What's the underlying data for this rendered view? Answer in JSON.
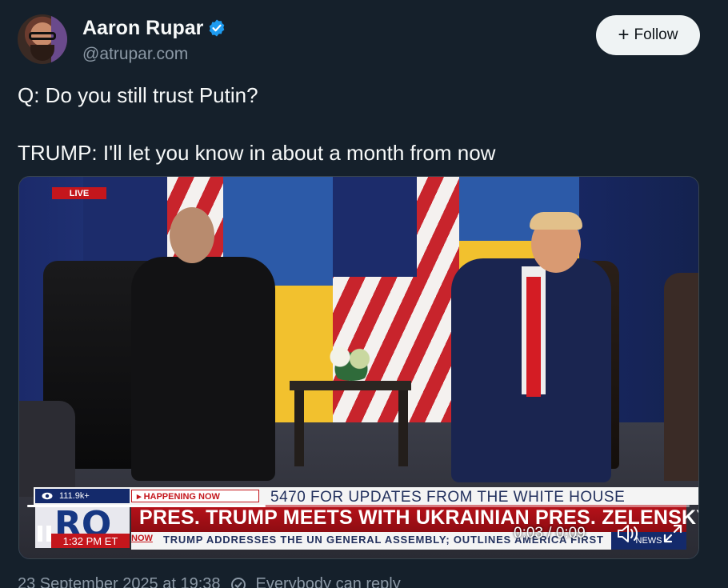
{
  "author": {
    "name": "Aaron Rupar",
    "handle": "@atrupar.com"
  },
  "follow_button": {
    "plus": "+",
    "label": "Follow"
  },
  "tweet": {
    "text": "Q: Do you still trust Putin?\n\nTRUMP: I'll let you know in about a month from now"
  },
  "video": {
    "live_badge": "LIVE",
    "views": "111.9k+",
    "happening_now": "▸ HAPPENING NOW",
    "top_ticker": "5470 FOR UPDATES FROM THE WHITE HOUSE",
    "logo": "RO",
    "headline": "PRES. TRUMP MEETS WITH UKRAINIAN PRES. ZELENSKYY",
    "now_tag": "NOW",
    "sub_ticker": "TRUMP ADDRESSES THE UN GENERAL ASSEMBLY; OUTLINES AMERICA FIRST",
    "clock": "1:32 PM ET",
    "network": "NEWS",
    "time": "0:03 / 0:09",
    "progress_fraction": 0.36
  },
  "footer": {
    "date": "23 September 2025 at 19:38",
    "reply_setting": "Everybody can reply"
  },
  "icons": {
    "verified": "verified-badge-icon",
    "pause": "pause-icon",
    "volume": "volume-icon",
    "expand": "expand-icon",
    "reply_setting": "reply-setting-icon"
  },
  "colors": {
    "background": "#15202b",
    "verified_blue": "#1d9bf0",
    "follow_bg": "#eff3f4",
    "news_red": "#c4161c",
    "news_blue": "#142a6b"
  }
}
